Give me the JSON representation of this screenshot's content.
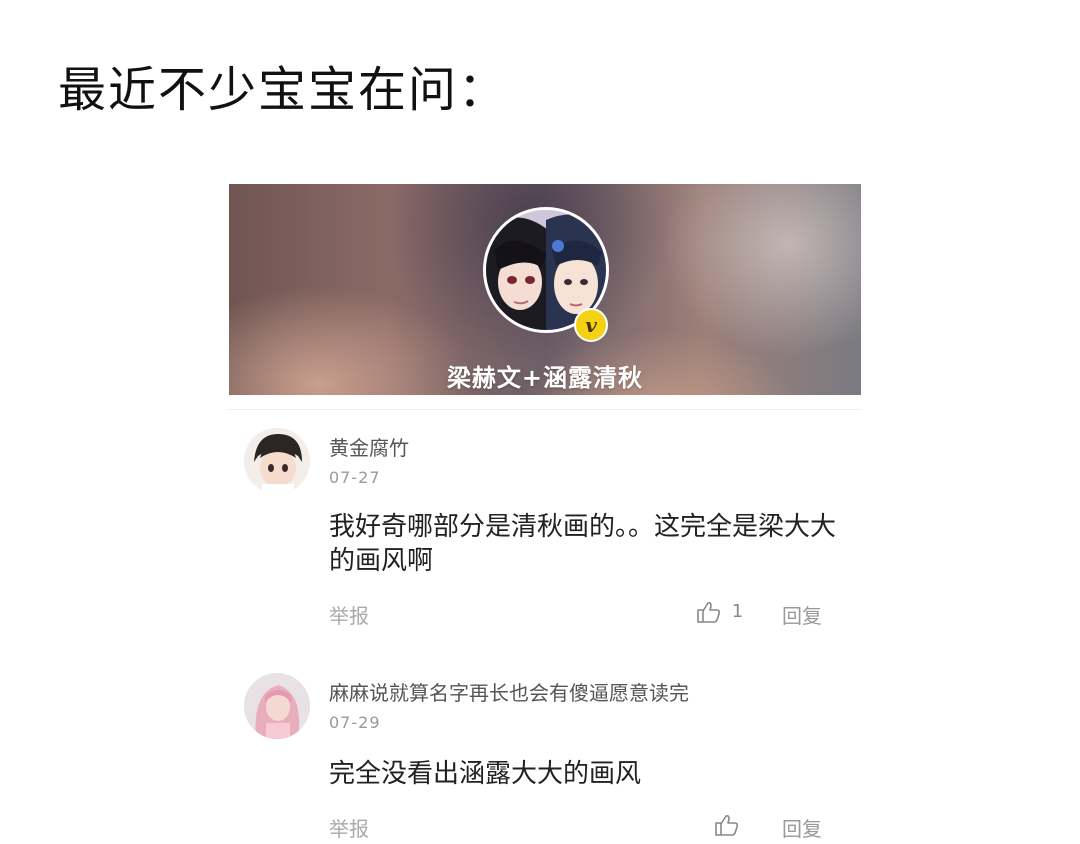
{
  "headline": "最近不少宝宝在问：",
  "banner": {
    "title": "梁赫文+涵露清秋",
    "avatar_icon": "dual-character-avatar",
    "verified_glyph": "v",
    "badge_color": "#f4d112"
  },
  "comments": [
    {
      "name": "黄金腐竹",
      "date": "07-27",
      "text": "我好奇哪部分是清秋画的。。这完全是梁大大的画风啊",
      "report": "举报",
      "like_count": "1",
      "reply": "回复"
    },
    {
      "name": "麻麻说就算名字再长也会有傻逼愿意读完",
      "date": "07-29",
      "text": "完全没看出涵露大大的画风",
      "report": "举报",
      "like_count": "",
      "reply": "回复"
    }
  ]
}
